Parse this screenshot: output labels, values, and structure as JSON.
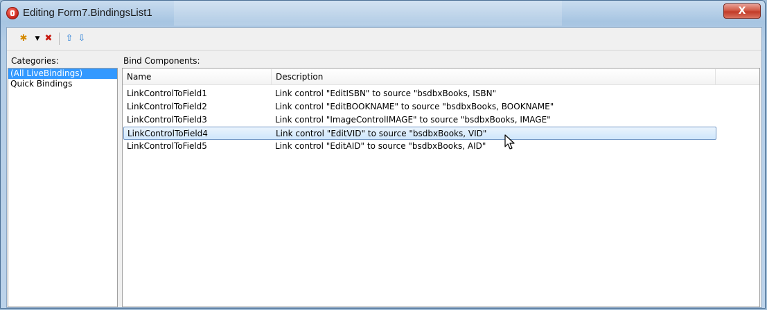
{
  "window": {
    "title": "Editing Form7.BindingsList1",
    "close_label": "X"
  },
  "toolbar": {
    "buttons": [
      {
        "name": "new-binding",
        "icon": "new-binding-icon"
      },
      {
        "name": "new-dropdown",
        "icon": "dropdown-arrow-icon"
      },
      {
        "name": "delete-binding",
        "icon": "delete-binding-icon"
      },
      {
        "name": "move-up",
        "icon": "arrow-up-icon"
      },
      {
        "name": "move-down",
        "icon": "arrow-down-icon"
      }
    ]
  },
  "categories": {
    "label": "Categories:",
    "items": [
      "(All LiveBindings)",
      "Quick Bindings"
    ],
    "selected_index": 0
  },
  "bind_components": {
    "label": "Bind Components:",
    "columns": [
      "Name",
      "Description"
    ],
    "rows": [
      {
        "name": "LinkControlToField1",
        "description": "Link control \"EditISBN\" to source \"bsdbxBooks, ISBN\""
      },
      {
        "name": "LinkControlToField2",
        "description": "Link control \"EditBOOKNAME\" to source \"bsdbxBooks, BOOKNAME\""
      },
      {
        "name": "LinkControlToField3",
        "description": "Link control \"ImageControlIMAGE\" to source \"bsdbxBooks, IMAGE\""
      },
      {
        "name": "LinkControlToField4",
        "description": "Link control \"EditVID\" to source \"bsdbxBooks, VID\""
      },
      {
        "name": "LinkControlToField5",
        "description": "Link control \"EditAID\" to source \"bsdbxBooks, AID\""
      }
    ],
    "selected_index": 3
  }
}
